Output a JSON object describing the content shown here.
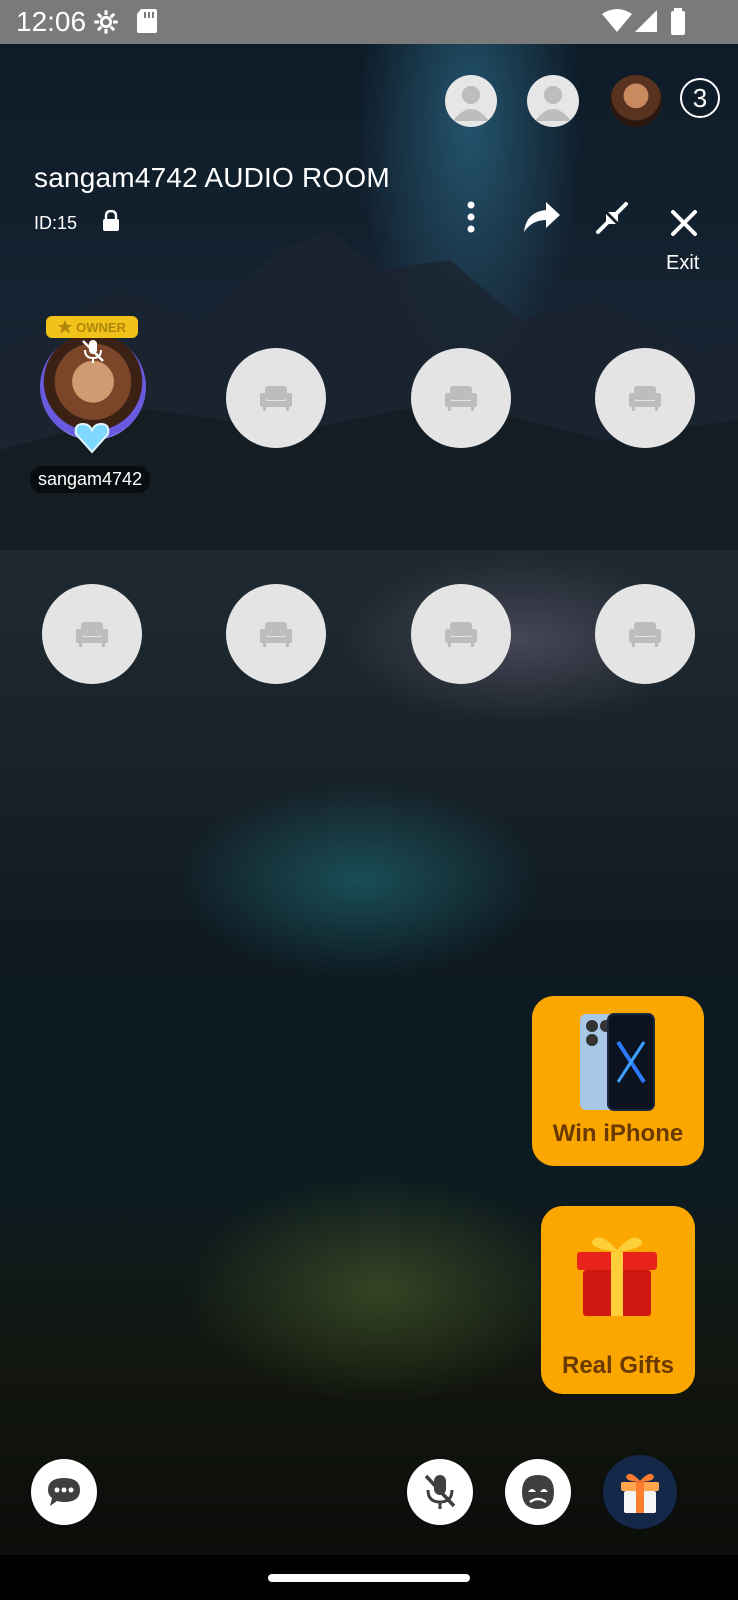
{
  "status_bar": {
    "time": "12:06"
  },
  "viewers": {
    "count": "3"
  },
  "room": {
    "title": "sangam4742 AUDIO ROOM",
    "id_label": "ID:15",
    "exit_label": "Exit"
  },
  "owner_seat": {
    "badge": "OWNER",
    "username": "sangam4742"
  },
  "promos": {
    "iphone_label": "Win iPhone",
    "gifts_label": "Real Gifts"
  },
  "colors": {
    "promo_bg": "#fca700",
    "seat_bg": "#e4e4e4"
  }
}
